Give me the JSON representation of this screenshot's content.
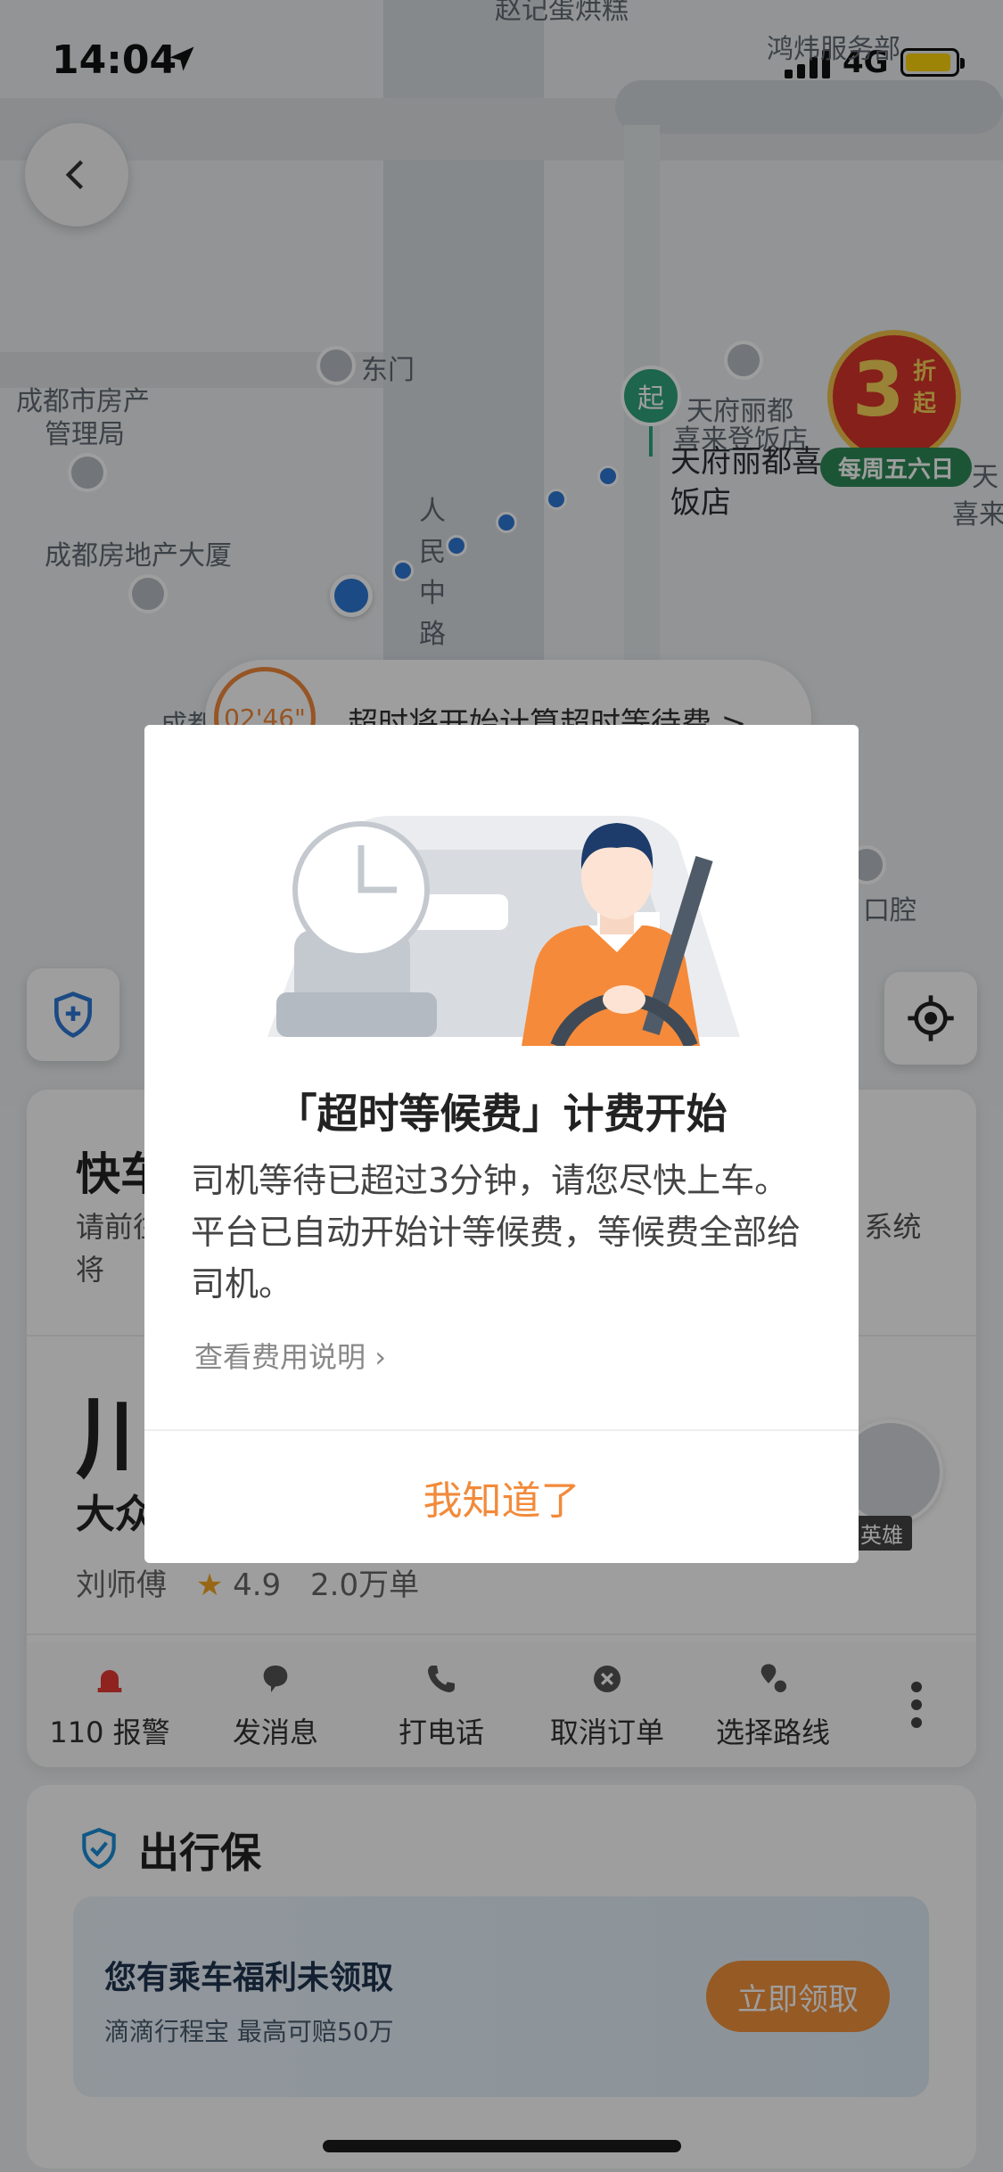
{
  "status_bar": {
    "time": "14:04",
    "network": "4G"
  },
  "map": {
    "labels": {
      "dongmen": "东门",
      "housing_bureau_1": "成都市房产",
      "housing_bureau_2": "管理局",
      "real_estate_building": "成都房地产大厦",
      "road_1": "人",
      "road_2": "民",
      "road_3": "中",
      "road_4": "路",
      "tianfu_small": "天府丽都",
      "tianfu_small_2": "喜来登饭店",
      "hotel_1": "天府丽都喜",
      "hotel_2": "饭店",
      "service": "鸿炜服务部",
      "top_cut": "赵记蛋烘糕",
      "right_cut_1": "天",
      "right_cut_2": "喜来",
      "dental": "口腔",
      "cheng": "成都"
    },
    "start_marker": "起",
    "promo": {
      "number": "3",
      "unit": "折",
      "unit2": "起",
      "ribbon": "每周五六日"
    },
    "wait_pill": {
      "timer": "02'46\"",
      "text": "超时将开始计算超时等待费 >"
    }
  },
  "card": {
    "title": "快车",
    "desc": "请前往上车点，司机等待超过3分钟后将开始计算超时等待费，系统将",
    "plate": "川",
    "model": "大众",
    "driver": "刘师傅",
    "rating": "4.9",
    "orders": "2.0万单",
    "avatar_tag": "英雄",
    "actions": [
      {
        "label": "110 报警",
        "icon": "alarm-icon"
      },
      {
        "label": "发消息",
        "icon": "message-icon"
      },
      {
        "label": "打电话",
        "icon": "phone-icon"
      },
      {
        "label": "取消订单",
        "icon": "cancel-icon"
      },
      {
        "label": "选择路线",
        "icon": "route-icon"
      }
    ]
  },
  "insurance": {
    "title": "出行保",
    "headline": "您有乘车福利未领取",
    "sub": "滴滴行程宝  最高可赔50万",
    "button": "立即领取"
  },
  "modal": {
    "title": "「超时等候费」计费开始",
    "body": "司机等待已超过3分钟，请您尽快上车。平台已自动开始计等候费，等候费全部给司机。",
    "link": "查看费用说明",
    "button": "我知道了"
  },
  "colors": {
    "accent": "#f28a3a",
    "route": "#2e78d6",
    "start": "#2fa37c",
    "promo": "#d9342b"
  }
}
